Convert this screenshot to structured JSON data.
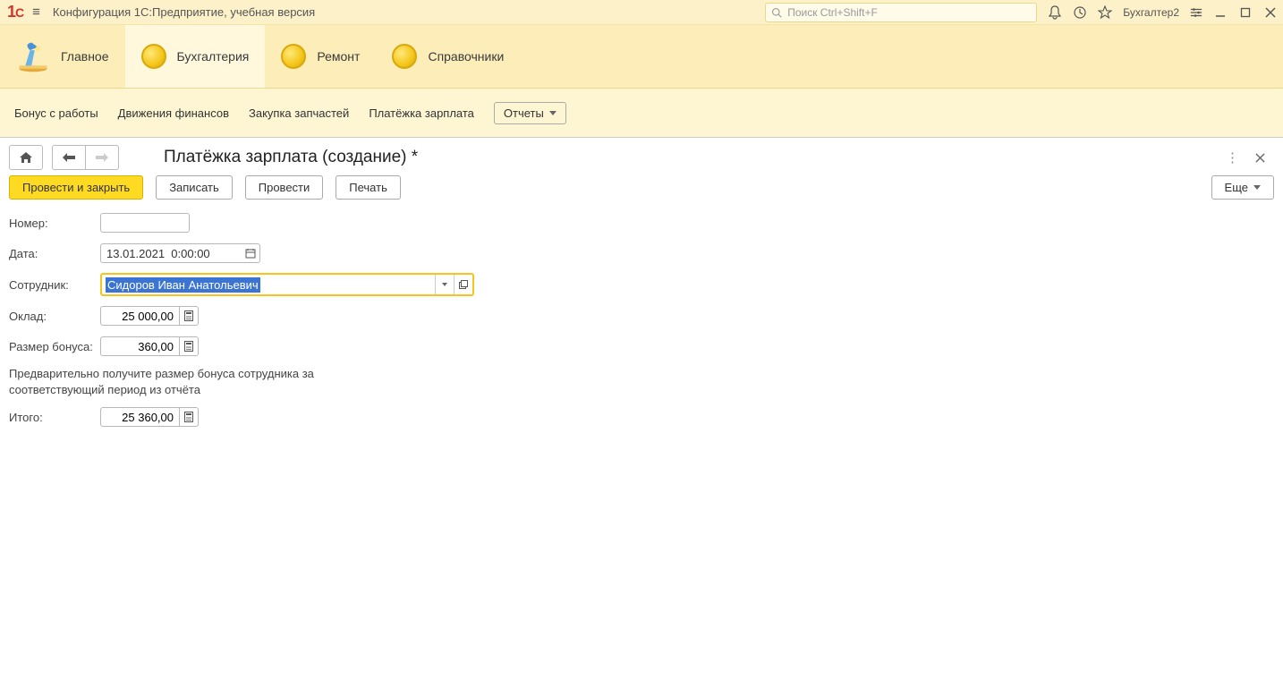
{
  "titlebar": {
    "title": "Конфигурация 1С:Предприятие, учебная версия",
    "search_placeholder": "Поиск Ctrl+Shift+F",
    "user": "Бухгалтер2"
  },
  "sections": {
    "main": "Главное",
    "accounting": "Бухгалтерия",
    "repair": "Ремонт",
    "directories": "Справочники"
  },
  "cmdbar": {
    "bonus": "Бонус с работы",
    "finance": "Движения финансов",
    "purchase": "Закупка запчастей",
    "salary": "Платёжка зарплата",
    "reports": "Отчеты"
  },
  "form": {
    "title": "Платёжка зарплата (создание) *",
    "post_and_close": "Провести и закрыть",
    "save": "Записать",
    "post": "Провести",
    "print": "Печать",
    "more": "Еще"
  },
  "fields": {
    "number_label": "Номер:",
    "number_value": "",
    "date_label": "Дата:",
    "date_value": "13.01.2021  0:00:00",
    "employee_label": "Сотрудник:",
    "employee_value": "Сидоров Иван Анатольевич",
    "salary_label": "Оклад:",
    "salary_value": "25 000,00",
    "bonus_label": "Размер бонуса:",
    "bonus_value": "360,00",
    "note": "Предварительно получите размер бонуса сотрудника за соответствующий период из отчёта",
    "total_label": "Итого:",
    "total_value": "25 360,00"
  }
}
